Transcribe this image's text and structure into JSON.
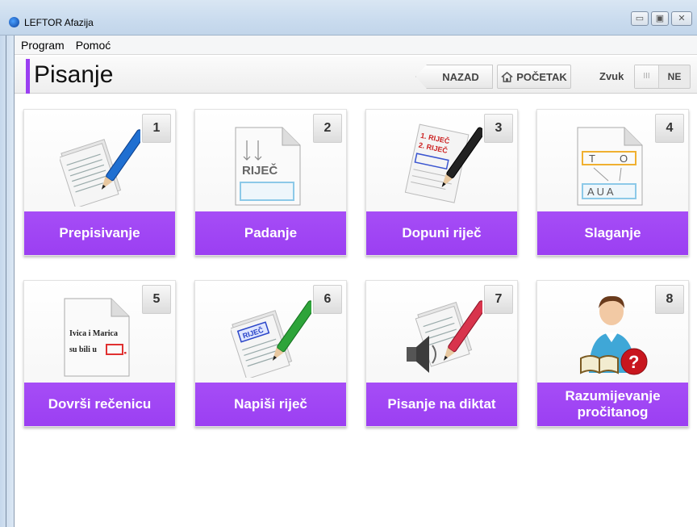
{
  "window": {
    "title": "LEFTOR Afazija",
    "buttons": {
      "minimize": "▭",
      "maximize": "▣",
      "close": "✕"
    }
  },
  "menu": [
    "Program",
    "Pomoć"
  ],
  "header": {
    "title": "Pisanje",
    "back_label": "NAZAD",
    "home_label": "POČETAK",
    "sound_label": "Zvuk",
    "sound_knob": "III",
    "sound_state": "NE",
    "accent": "#9b3ff2"
  },
  "tiles": [
    {
      "number": "1",
      "label": "Prepisivanje",
      "icon": "papers-pen-icon"
    },
    {
      "number": "2",
      "label": "Padanje",
      "icon": "falling-letters-icon",
      "art_text": "RIJEČ"
    },
    {
      "number": "3",
      "label": "Dopuni riječ",
      "icon": "fill-word-icon",
      "art_text": [
        "1. RIJEČ",
        "2. RIJEČ"
      ]
    },
    {
      "number": "4",
      "label": "Slaganje",
      "icon": "arrange-letters-icon",
      "art_text": [
        "T",
        "O",
        "A U A"
      ]
    },
    {
      "number": "5",
      "label": "Dovrši rečenicu",
      "icon": "sentence-icon",
      "art_text": [
        "Ivica i Marica",
        "su bili u"
      ]
    },
    {
      "number": "6",
      "label": "Napiši riječ",
      "icon": "write-word-icon",
      "art_text": "RIJEČ"
    },
    {
      "number": "7",
      "label": "Pisanje na diktat",
      "icon": "dictation-icon"
    },
    {
      "number": "8",
      "label": "Razumijevanje pročitanog",
      "icon": "reading-comprehension-icon"
    }
  ]
}
